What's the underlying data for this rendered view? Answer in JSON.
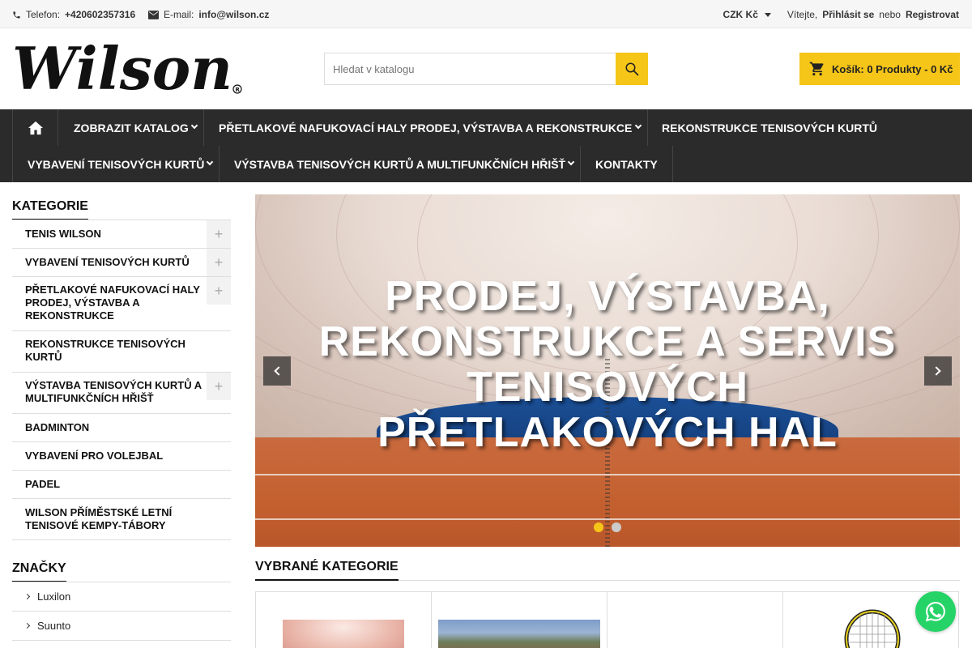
{
  "topbar": {
    "phone_label": "Telefon:",
    "phone": "+420602357316",
    "email_label": "E-mail:",
    "email": "info@wilson.cz",
    "currency": "CZK Kč",
    "welcome": "Vítejte,",
    "login": "Přihlásit se",
    "or": "nebo",
    "register": "Registrovat"
  },
  "header": {
    "logo_text": "Wilson",
    "search_placeholder": "Hledat v katalogu",
    "cart_label": "Košík: 0 Produkty - 0 Kč"
  },
  "nav": {
    "items": [
      "ZOBRAZIT KATALOG",
      "PŘETLAKOVÉ NAFUKOVACÍ HALY PRODEJ, VÝSTAVBA A REKONSTRUKCE",
      "REKONSTRUKCE TENISOVÝCH KURTŮ",
      "VYBAVENÍ TENISOVÝCH KURTŮ",
      "VÝSTAVBA TENISOVÝCH KURTŮ A MULTIFUNKČNÍCH HŘIŠŤ",
      "KONTAKTY"
    ]
  },
  "sidebar": {
    "categories_title": "KATEGORIE",
    "categories": [
      "TENIS WILSON",
      "VYBAVENÍ TENISOVÝCH KURTŮ",
      "PŘETLAKOVÉ NAFUKOVACÍ HALY PRODEJ, VÝSTAVBA A REKONSTRUKCE",
      "REKONSTRUKCE TENISOVÝCH KURTŮ",
      "VÝSTAVBA TENISOVÝCH KURTŮ A MULTIFUNKČNÍCH HŘIŠŤ",
      "BADMINTON",
      "VYBAVENÍ PRO VOLEJBAL",
      "PADEL",
      "WILSON PŘÍMĚSTSKÉ LETNÍ TENISOVÉ KEMPY-TÁBORY"
    ],
    "brands_title": "ZNAČKY",
    "brands": [
      "Luxilon",
      "Suunto"
    ]
  },
  "slider": {
    "headline": "PRODEJ, VÝSTAVBA, REKONSTRUKCE A SERVIS TENISOVÝCH PŘETLAKOVÝCH HAL",
    "slide_count": 2,
    "active_slide": 1
  },
  "featured": {
    "title": "VYBRANÉ KATEGORIE"
  },
  "colors": {
    "accent": "#f5c518",
    "nav_bg": "#2b2b2b",
    "whatsapp": "#25d366"
  }
}
